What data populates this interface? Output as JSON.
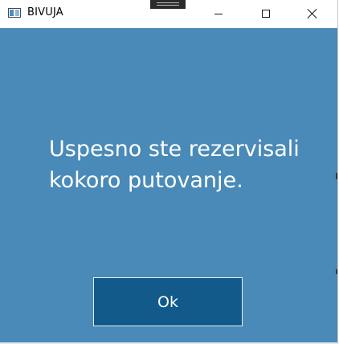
{
  "window": {
    "title": "BIVUJA",
    "icon": "app-window-icon"
  },
  "titlebar": {
    "minimize_icon": "minimize-icon",
    "maximize_icon": "maximize-icon",
    "close_icon": "close-icon"
  },
  "dialog": {
    "message": "Uspesno ste rezervisali kokoro putovanje.",
    "ok_label": "Ok"
  },
  "colors": {
    "background": "#4a8ab8",
    "button": "#115a8a",
    "text": "#ffffff"
  }
}
